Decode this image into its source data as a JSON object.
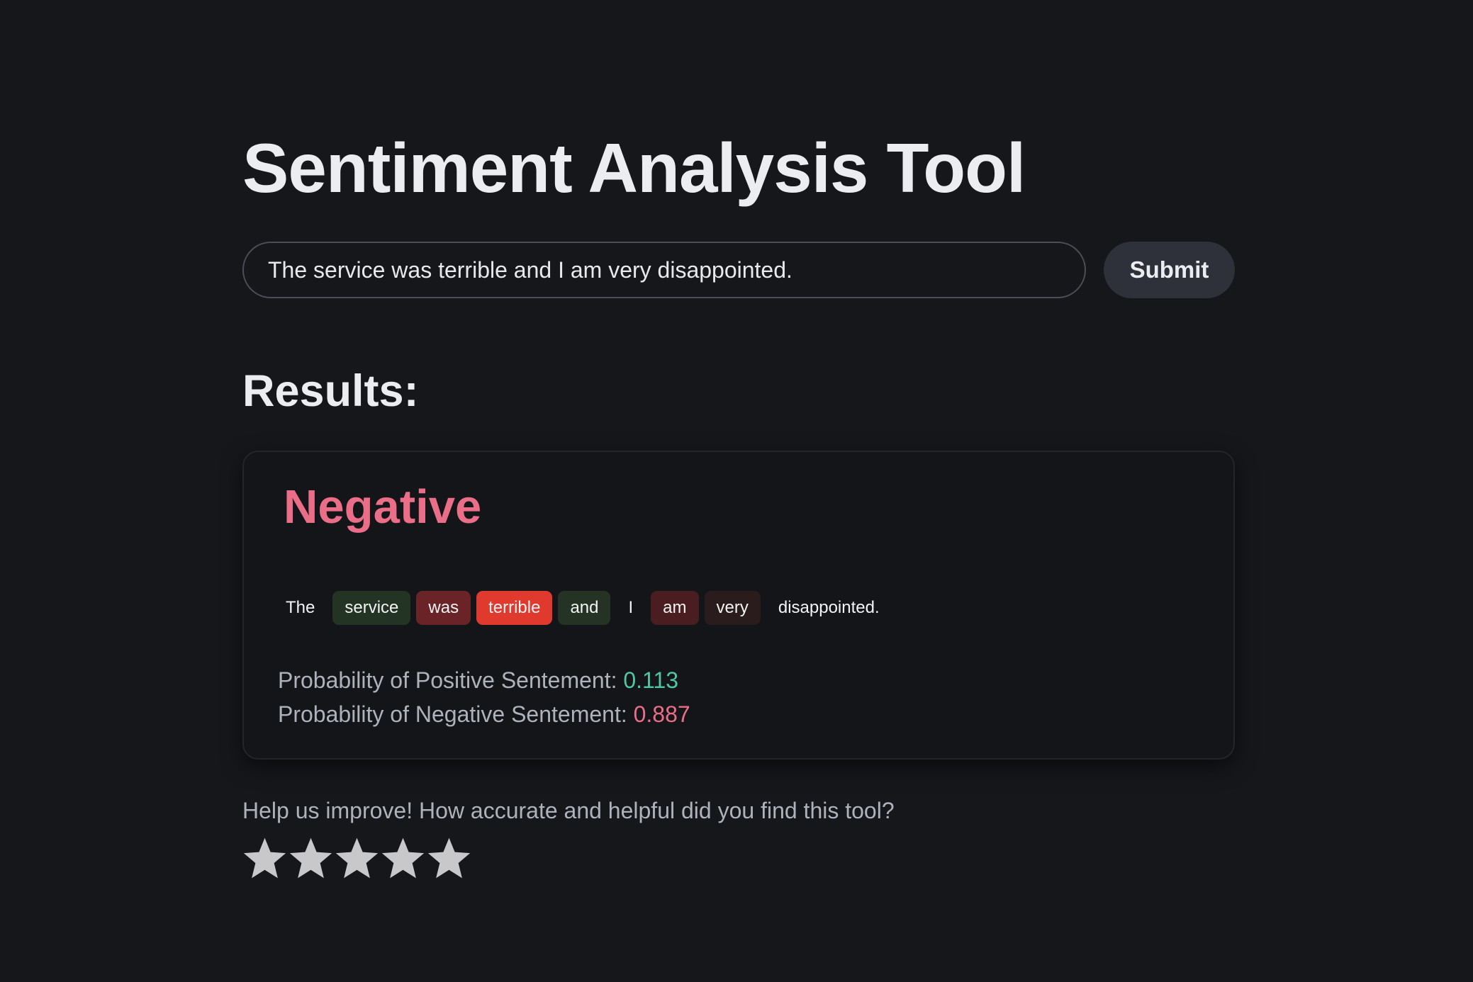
{
  "page": {
    "title": "Sentiment Analysis Tool"
  },
  "input": {
    "value": "The service was terrible and I am very disappointed.",
    "submit_label": "Submit"
  },
  "results": {
    "heading": "Results:",
    "verdict": "Negative",
    "verdict_color": "#ea6e87",
    "tokens": [
      {
        "text": "The",
        "bg": "transparent"
      },
      {
        "text": "service",
        "bg": "#233324"
      },
      {
        "text": "was",
        "bg": "#6a2427"
      },
      {
        "text": "terrible",
        "bg": "#e03a2e"
      },
      {
        "text": "and",
        "bg": "#253325"
      },
      {
        "text": "I",
        "bg": "transparent"
      },
      {
        "text": "am",
        "bg": "#4a1e20"
      },
      {
        "text": "very",
        "bg": "#2a1b1d"
      },
      {
        "text": "disappointed.",
        "bg": "transparent"
      }
    ],
    "positive_label": "Probability of Positive Sentement: ",
    "positive_value": "0.113",
    "negative_label": "Probability of Negative Sentement: ",
    "negative_value": "0.887",
    "positive_color": "#4fc7a1",
    "negative_color": "#ea6e87"
  },
  "feedback": {
    "prompt": "Help us improve! How accurate and helpful did you find this tool?",
    "rating_max": 5,
    "rating_selected": 0,
    "star_icon": "star-icon",
    "star_color": "#c8c8ca"
  }
}
